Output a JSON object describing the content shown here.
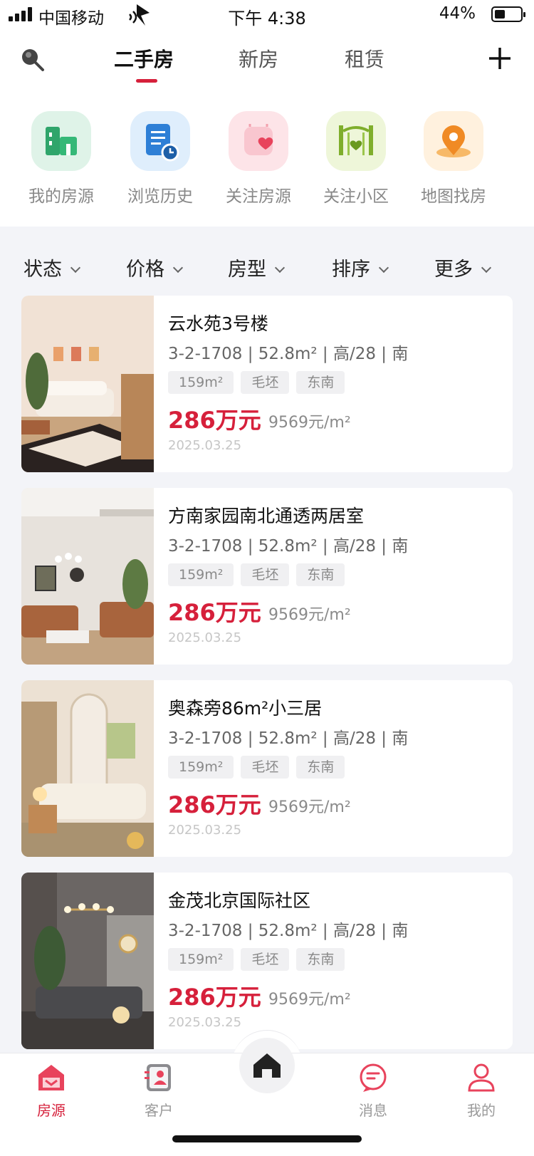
{
  "status_bar": {
    "carrier": "中国移动",
    "time": "下午 4:38",
    "battery": "44%"
  },
  "header": {
    "tabs": [
      {
        "label": "二手房",
        "active": true
      },
      {
        "label": "新房",
        "active": false
      },
      {
        "label": "租赁",
        "active": false
      }
    ],
    "search_icon": "search-icon",
    "add_icon": "plus-icon"
  },
  "quick_entries": [
    {
      "label": "我的房源",
      "icon": "building-icon",
      "bg": "#dff3e8",
      "color": "#2fa56b"
    },
    {
      "label": "浏览历史",
      "icon": "history-doc-icon",
      "bg": "#dfeefc",
      "color": "#2e7fd6"
    },
    {
      "label": "关注房源",
      "icon": "heart-bag-icon",
      "bg": "#fde4e8",
      "color": "#e8435c"
    },
    {
      "label": "关注小区",
      "icon": "community-gate-icon",
      "bg": "#eef6d9",
      "color": "#7fae2c"
    },
    {
      "label": "地图找房",
      "icon": "map-pin-icon",
      "bg": "#fff1de",
      "color": "#f08a24"
    }
  ],
  "filters": [
    {
      "label": "状态"
    },
    {
      "label": "价格"
    },
    {
      "label": "房型"
    },
    {
      "label": "排序"
    },
    {
      "label": "更多"
    }
  ],
  "listings": [
    {
      "title": "云水苑3号楼",
      "meta": "3-2-1708 | 52.8m² | 高/28 | 南",
      "tags": [
        "159m²",
        "毛坯",
        "东南"
      ],
      "price": "286万元",
      "unit_price": "9569元/m²",
      "date": "2025.03.25"
    },
    {
      "title": "方南家园南北通透两居室",
      "meta": "3-2-1708 | 52.8m² | 高/28 | 南",
      "tags": [
        "159m²",
        "毛坯",
        "东南"
      ],
      "price": "286万元",
      "unit_price": "9569元/m²",
      "date": "2025.03.25"
    },
    {
      "title": "奥森旁86m²小三居",
      "meta": "3-2-1708 | 52.8m² | 高/28 | 南",
      "tags": [
        "159m²",
        "毛坯",
        "东南"
      ],
      "price": "286万元",
      "unit_price": "9569元/m²",
      "date": "2025.03.25"
    },
    {
      "title": "金茂北京国际社区",
      "meta": "3-2-1708 | 52.8m² | 高/28 | 南",
      "tags": [
        "159m²",
        "毛坯",
        "东南"
      ],
      "price": "286万元",
      "unit_price": "9569元/m²",
      "date": "2025.03.25"
    }
  ],
  "bottom_nav": {
    "items": [
      {
        "label": "房源",
        "icon": "house-listing-icon",
        "active": true
      },
      {
        "label": "客户",
        "icon": "contacts-icon",
        "active": false
      },
      {
        "label": "消息",
        "icon": "message-icon",
        "active": false
      },
      {
        "label": "我的",
        "icon": "profile-icon",
        "active": false
      }
    ],
    "center_icon": "home-icon"
  },
  "colors": {
    "accent": "#d6203b",
    "background": "#f3f4f8"
  }
}
